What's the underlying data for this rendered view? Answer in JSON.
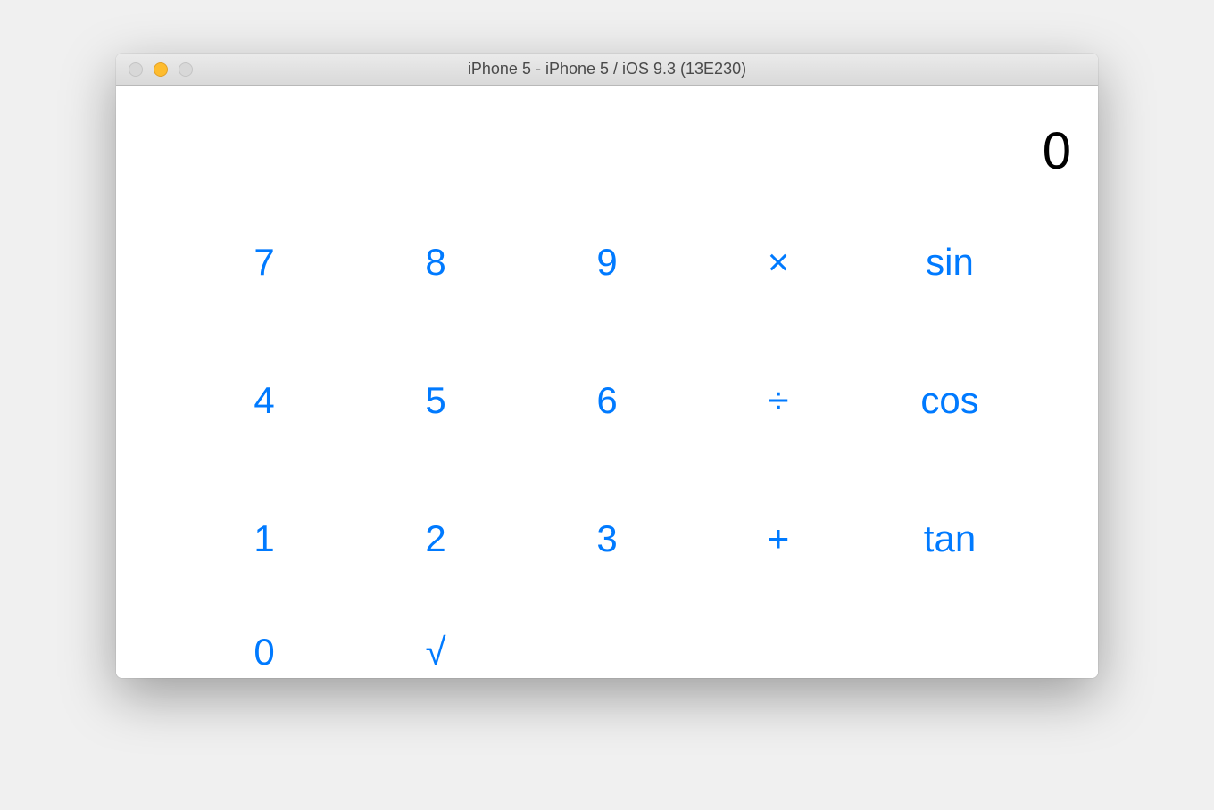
{
  "window": {
    "title": "iPhone 5 - iPhone 5 / iOS 9.3 (13E230)"
  },
  "display": {
    "value": "0"
  },
  "keypad": {
    "row1": {
      "c1": "7",
      "c2": "8",
      "c3": "9",
      "c4": "×",
      "c5": "sin"
    },
    "row2": {
      "c1": "4",
      "c2": "5",
      "c3": "6",
      "c4": "÷",
      "c5": "cos"
    },
    "row3": {
      "c1": "1",
      "c2": "2",
      "c3": "3",
      "c4": "+",
      "c5": "tan"
    },
    "row4": {
      "c1": "0",
      "c2": "√",
      "c3": "",
      "c4": "",
      "c5": ""
    }
  },
  "colors": {
    "accent": "#007aff",
    "text": "#000000"
  }
}
